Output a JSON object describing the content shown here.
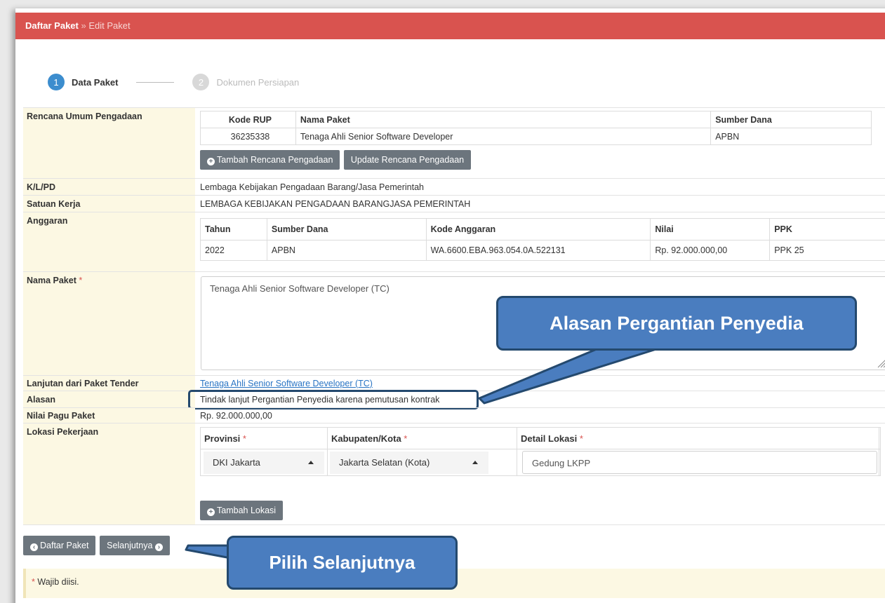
{
  "breadcrumb": {
    "root": "Daftar Paket",
    "separator": "»",
    "current": "Edit Paket"
  },
  "wizard": {
    "steps": [
      {
        "num": "1",
        "label": "Data Paket"
      },
      {
        "num": "2",
        "label": "Dokumen Persiapan"
      }
    ]
  },
  "rup": {
    "label": "Rencana Umum Pengadaan",
    "headers": [
      "Kode RUP",
      "Nama Paket",
      "Sumber Dana"
    ],
    "row": [
      "36235338",
      "Tenaga Ahli Senior Software Developer",
      "APBN"
    ],
    "btn_add": "Tambah Rencana Pengadaan",
    "btn_update": "Update Rencana Pengadaan"
  },
  "klpd": {
    "label": "K/L/PD",
    "value": "Lembaga Kebijakan Pengadaan Barang/Jasa Pemerintah"
  },
  "satker": {
    "label": "Satuan Kerja",
    "value": "LEMBAGA KEBIJAKAN PENGADAAN BARANGJASA PEMERINTAH"
  },
  "anggaran": {
    "label": "Anggaran",
    "headers": [
      "Tahun",
      "Sumber Dana",
      "Kode Anggaran",
      "Nilai",
      "PPK"
    ],
    "row": [
      "2022",
      "APBN",
      "WA.6600.EBA.963.054.0A.522131",
      "Rp. 92.000.000,00",
      "PPK 25"
    ]
  },
  "nama_paket": {
    "label": "Nama Paket",
    "required": "*",
    "value": "Tenaga Ahli Senior Software Developer (TC)"
  },
  "lanjutan": {
    "label": "Lanjutan dari Paket Tender",
    "value": "Tenaga Ahli Senior Software Developer (TC)"
  },
  "alasan": {
    "label": "Alasan",
    "value": "Tindak lanjut Pergantian Penyedia karena pemutusan kontrak"
  },
  "pagu": {
    "label": "Nilai Pagu Paket",
    "value": "Rp. 92.000.000,00"
  },
  "lokasi": {
    "label": "Lokasi Pekerjaan",
    "headers": [
      "Provinsi",
      "Kabupaten/Kota",
      "Detail Lokasi"
    ],
    "required": "*",
    "provinsi": "DKI Jakarta",
    "kota": "Jakarta Selatan (Kota)",
    "detail": "Gedung LKPP",
    "btn_add": "Tambah Lokasi"
  },
  "footer": {
    "btn_back": "Daftar Paket",
    "btn_next": "Selanjutnya",
    "note_star": "*",
    "note_text": "Wajib diisi."
  },
  "callouts": {
    "alasan": "Alasan Pergantian Penyedia",
    "next": "Pilih Selanjutnya"
  },
  "colors": {
    "topbar": "#d9534f",
    "label_bg": "#fcf8e3",
    "button": "#6c757d",
    "callout": "#4a7dbf",
    "callout_border": "#24496e",
    "step_active": "#3c8dce"
  }
}
